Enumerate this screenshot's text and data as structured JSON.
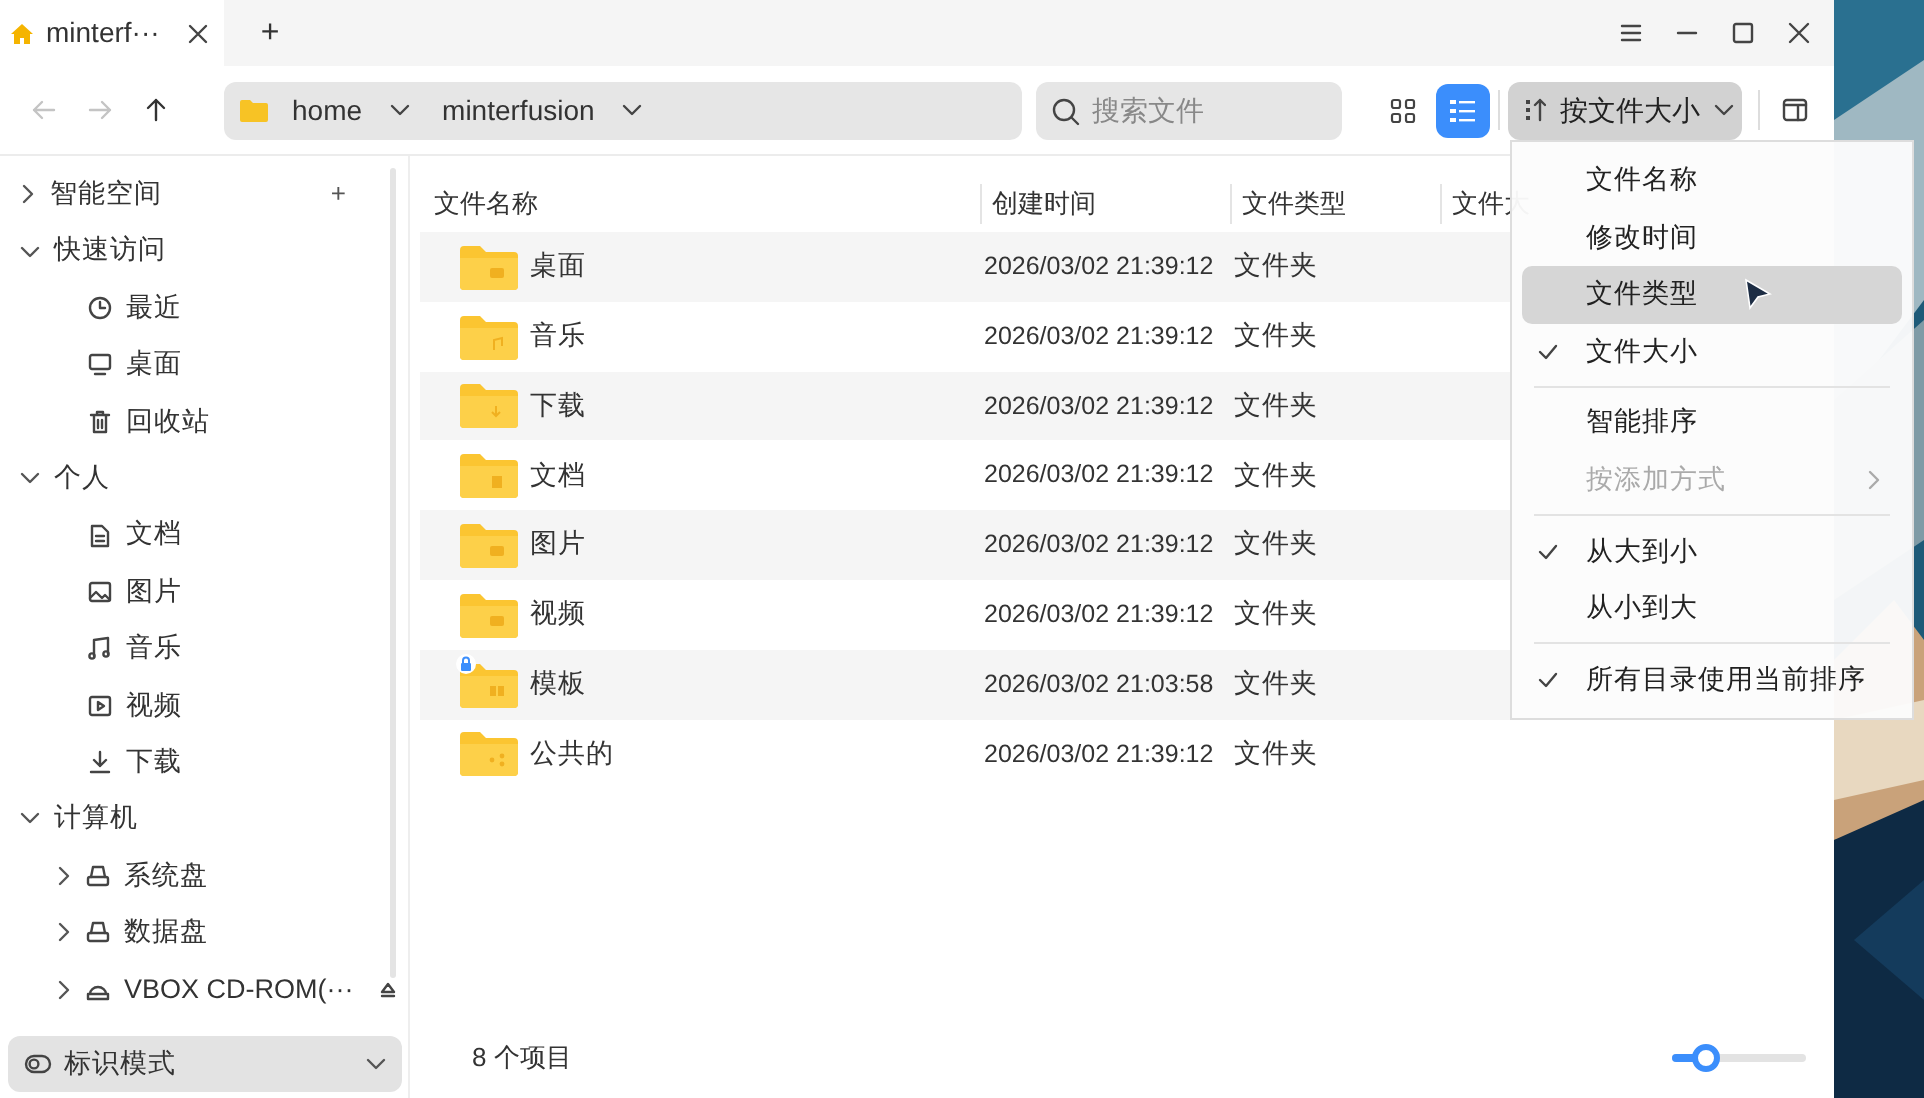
{
  "tab": {
    "title": "minterf···",
    "selected": true,
    "new_tab": "+"
  },
  "toolbar": {
    "back": {
      "disabled": true
    },
    "forward": {
      "disabled": true
    },
    "up": {
      "disabled": false
    },
    "breadcrumb": [
      {
        "label": "home"
      },
      {
        "label": "minterfusion"
      }
    ],
    "search": {
      "placeholder": "搜索文件"
    },
    "view_modes": [
      {
        "selected": false
      },
      {
        "selected": true
      }
    ],
    "sort_button": {
      "label": "按文件大小"
    }
  },
  "sidebar": {
    "groups": [
      {
        "label": "智能空间",
        "expanded": false,
        "add": "+"
      },
      {
        "label": "快速访问",
        "expanded": true,
        "children": [
          {
            "label": "最近"
          },
          {
            "label": "桌面"
          },
          {
            "label": "回收站"
          }
        ]
      },
      {
        "label": "个人",
        "expanded": true,
        "children": [
          {
            "label": "文档"
          },
          {
            "label": "图片"
          },
          {
            "label": "音乐"
          },
          {
            "label": "视频"
          },
          {
            "label": "下载"
          }
        ]
      },
      {
        "label": "计算机",
        "expanded": true,
        "children": [
          {
            "label": "系统盘",
            "expanded": false
          },
          {
            "label": "数据盘",
            "expanded": false
          },
          {
            "label": "VBOX CD-ROM(···",
            "expanded": false,
            "ejectable": true
          }
        ]
      }
    ],
    "mode_selector": {
      "label": "标识模式"
    }
  },
  "table": {
    "columns": [
      "文件名称",
      "创建时间",
      "文件类型",
      "文件大"
    ],
    "rows": [
      {
        "name": "桌面",
        "created": "2026/03/02 21:39:12",
        "type": "文件夹",
        "locked": false
      },
      {
        "name": "音乐",
        "created": "2026/03/02 21:39:12",
        "type": "文件夹",
        "locked": false
      },
      {
        "name": "下载",
        "created": "2026/03/02 21:39:12",
        "type": "文件夹",
        "locked": false
      },
      {
        "name": "文档",
        "created": "2026/03/02 21:39:12",
        "type": "文件夹",
        "locked": false
      },
      {
        "name": "图片",
        "created": "2026/03/02 21:39:12",
        "type": "文件夹",
        "locked": false
      },
      {
        "name": "视频",
        "created": "2026/03/02 21:39:12",
        "type": "文件夹",
        "locked": false
      },
      {
        "name": "模板",
        "created": "2026/03/02 21:03:58",
        "type": "文件夹",
        "locked": true
      },
      {
        "name": "公共的",
        "created": "2026/03/02 21:39:12",
        "type": "文件夹",
        "locked": false
      }
    ]
  },
  "status_bar": {
    "count": "8 个项目",
    "zoom": {
      "level": 0.25
    }
  },
  "sort_menu": {
    "groups": [
      [
        {
          "label": "文件名称",
          "checked": false,
          "selected": false,
          "disabled": false
        },
        {
          "label": "修改时间",
          "checked": false,
          "selected": false,
          "disabled": false
        },
        {
          "label": "文件类型",
          "checked": false,
          "selected": true,
          "disabled": false
        },
        {
          "label": "文件大小",
          "checked": true,
          "selected": false,
          "disabled": false
        }
      ],
      [
        {
          "label": "智能排序",
          "checked": false,
          "selected": false,
          "disabled": false
        },
        {
          "label": "按添加方式",
          "checked": false,
          "selected": false,
          "disabled": true,
          "submenu": true
        }
      ],
      [
        {
          "label": "从大到小",
          "checked": true,
          "selected": false,
          "disabled": false
        },
        {
          "label": "从小到大",
          "checked": false,
          "selected": false,
          "disabled": false
        }
      ],
      [
        {
          "label": "所有目录使用当前排序",
          "checked": true,
          "selected": false,
          "disabled": false
        }
      ]
    ]
  }
}
